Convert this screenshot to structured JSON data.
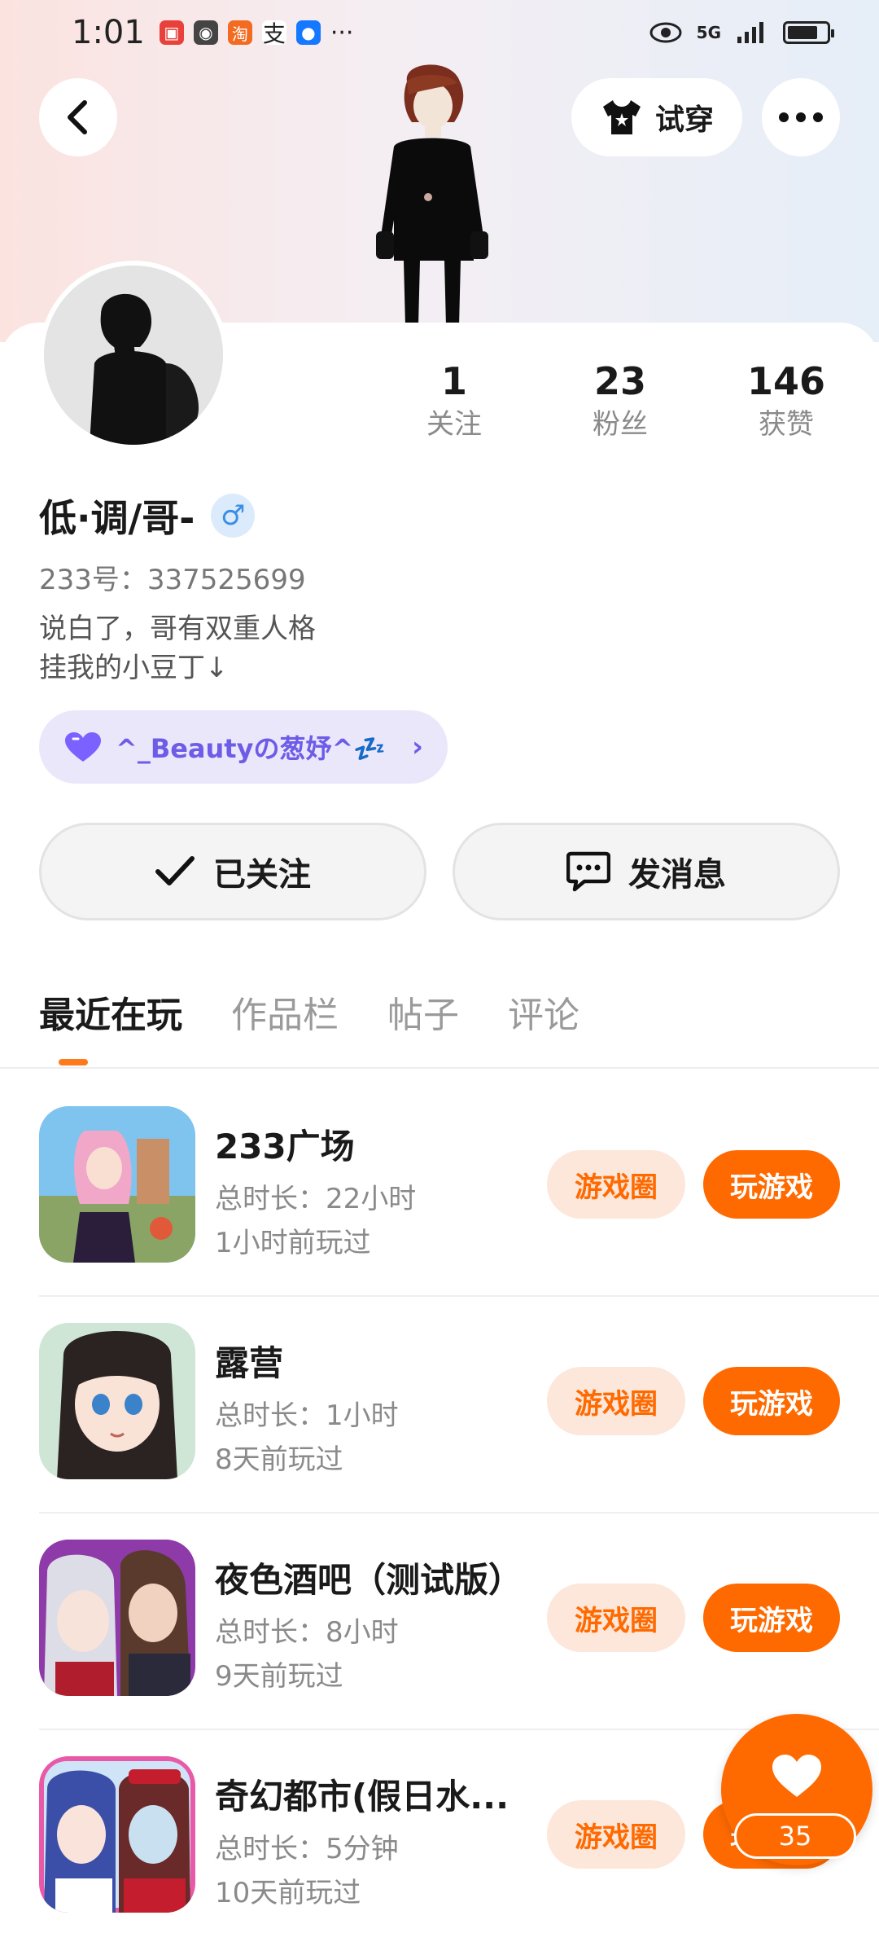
{
  "status_bar": {
    "time": "1:01",
    "more_dots": "···",
    "network": "5G"
  },
  "header": {
    "tryon_label": "试穿"
  },
  "profile": {
    "stats": [
      {
        "value": "1",
        "label": "关注"
      },
      {
        "value": "23",
        "label": "粉丝"
      },
      {
        "value": "146",
        "label": "获赞"
      }
    ],
    "name": "低·调/哥-",
    "gender_symbol": "♂",
    "uid": "233号：337525699",
    "bio_line1": "说白了，哥有双重人格",
    "bio_line2": "挂我的小豆丁↓",
    "family_tag": "^_Beautyの葱妤^💤"
  },
  "actions": {
    "follow_label": "已关注",
    "message_label": "发消息"
  },
  "tabs": [
    "最近在玩",
    "作品栏",
    "帖子",
    "评论"
  ],
  "games": [
    {
      "title": "233广场",
      "duration": "总时长：22小时",
      "last_played": "1小时前玩过",
      "circle_label": "游戏圈",
      "play_label": "玩游戏"
    },
    {
      "title": "露营",
      "duration": "总时长：1小时",
      "last_played": "8天前玩过",
      "circle_label": "游戏圈",
      "play_label": "玩游戏"
    },
    {
      "title": "夜色酒吧（测试版）",
      "duration": "总时长：8小时",
      "last_played": "9天前玩过",
      "circle_label": "游戏圈",
      "play_label": "玩游戏"
    },
    {
      "title": "奇幻都市(假日水...",
      "duration": "总时长：5分钟",
      "last_played": "10天前玩过",
      "circle_label": "游戏圈",
      "play_label": "玩游戏"
    }
  ],
  "floating_like": {
    "count": "35"
  },
  "colors": {
    "accent": "#ff6a00",
    "accent_light": "#fde6da",
    "family_tag_bg": "#ebe7fb",
    "family_tag_text": "#6c5ce7"
  }
}
